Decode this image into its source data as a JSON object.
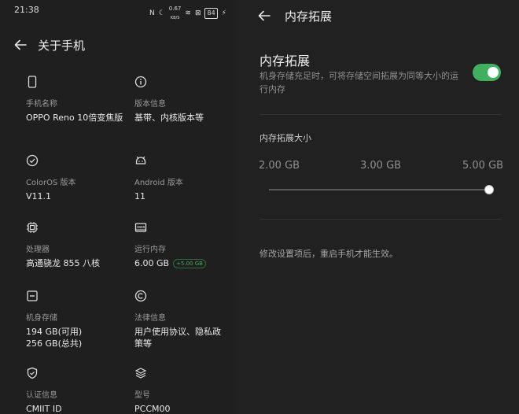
{
  "status_bar": {
    "time": "21:38",
    "nfc": "N",
    "moon": "☾",
    "speed": "0.67",
    "speed_unit": "KB/S",
    "wifi": "≋",
    "sim": "⊠",
    "battery": "84",
    "charging": "⚡"
  },
  "about_phone": {
    "title": "关于手机",
    "items": [
      {
        "icon": "phone-icon",
        "label": "手机名称",
        "value": "OPPO Reno 10倍变焦版"
      },
      {
        "icon": "info-icon",
        "label": "版本信息",
        "value": "基带、内核版本等"
      },
      {
        "icon": "check-circle-icon",
        "label": "ColorOS 版本",
        "value": "V11.1"
      },
      {
        "icon": "android-icon",
        "label": "Android 版本",
        "value": "11"
      },
      {
        "icon": "chip-icon",
        "label": "处理器",
        "value": "高通骁龙 855 八核"
      },
      {
        "icon": "memory-icon",
        "label": "运行内存",
        "value": "6.00 GB",
        "badge": "+5.00 GB"
      },
      {
        "icon": "storage-icon",
        "label": "机身存储",
        "value_lines": [
          "194 GB(可用)",
          "256 GB(总共)"
        ]
      },
      {
        "icon": "copyright-icon",
        "label": "法律信息",
        "value": "用户使用协议、隐私政策等"
      },
      {
        "icon": "shield-check-icon",
        "label": "认证信息",
        "value": "CMIIT ID"
      },
      {
        "icon": "layers-icon",
        "label": "型号",
        "value": "PCCM00"
      }
    ]
  },
  "memory_expansion": {
    "title": "内存拓展",
    "section_title": "内存拓展",
    "section_desc": "机身存储充足时，可将存储空间拓展为同等大小的运行内存",
    "toggle_on": true,
    "size_title": "内存拓展大小",
    "options": [
      "2.00 GB",
      "3.00 GB",
      "5.00 GB"
    ],
    "selected": "5.00 GB",
    "note": "修改设置项后，重启手机才能生效。"
  },
  "colors": {
    "accent": "#3fb05d",
    "bg": "#1f1f1f"
  }
}
